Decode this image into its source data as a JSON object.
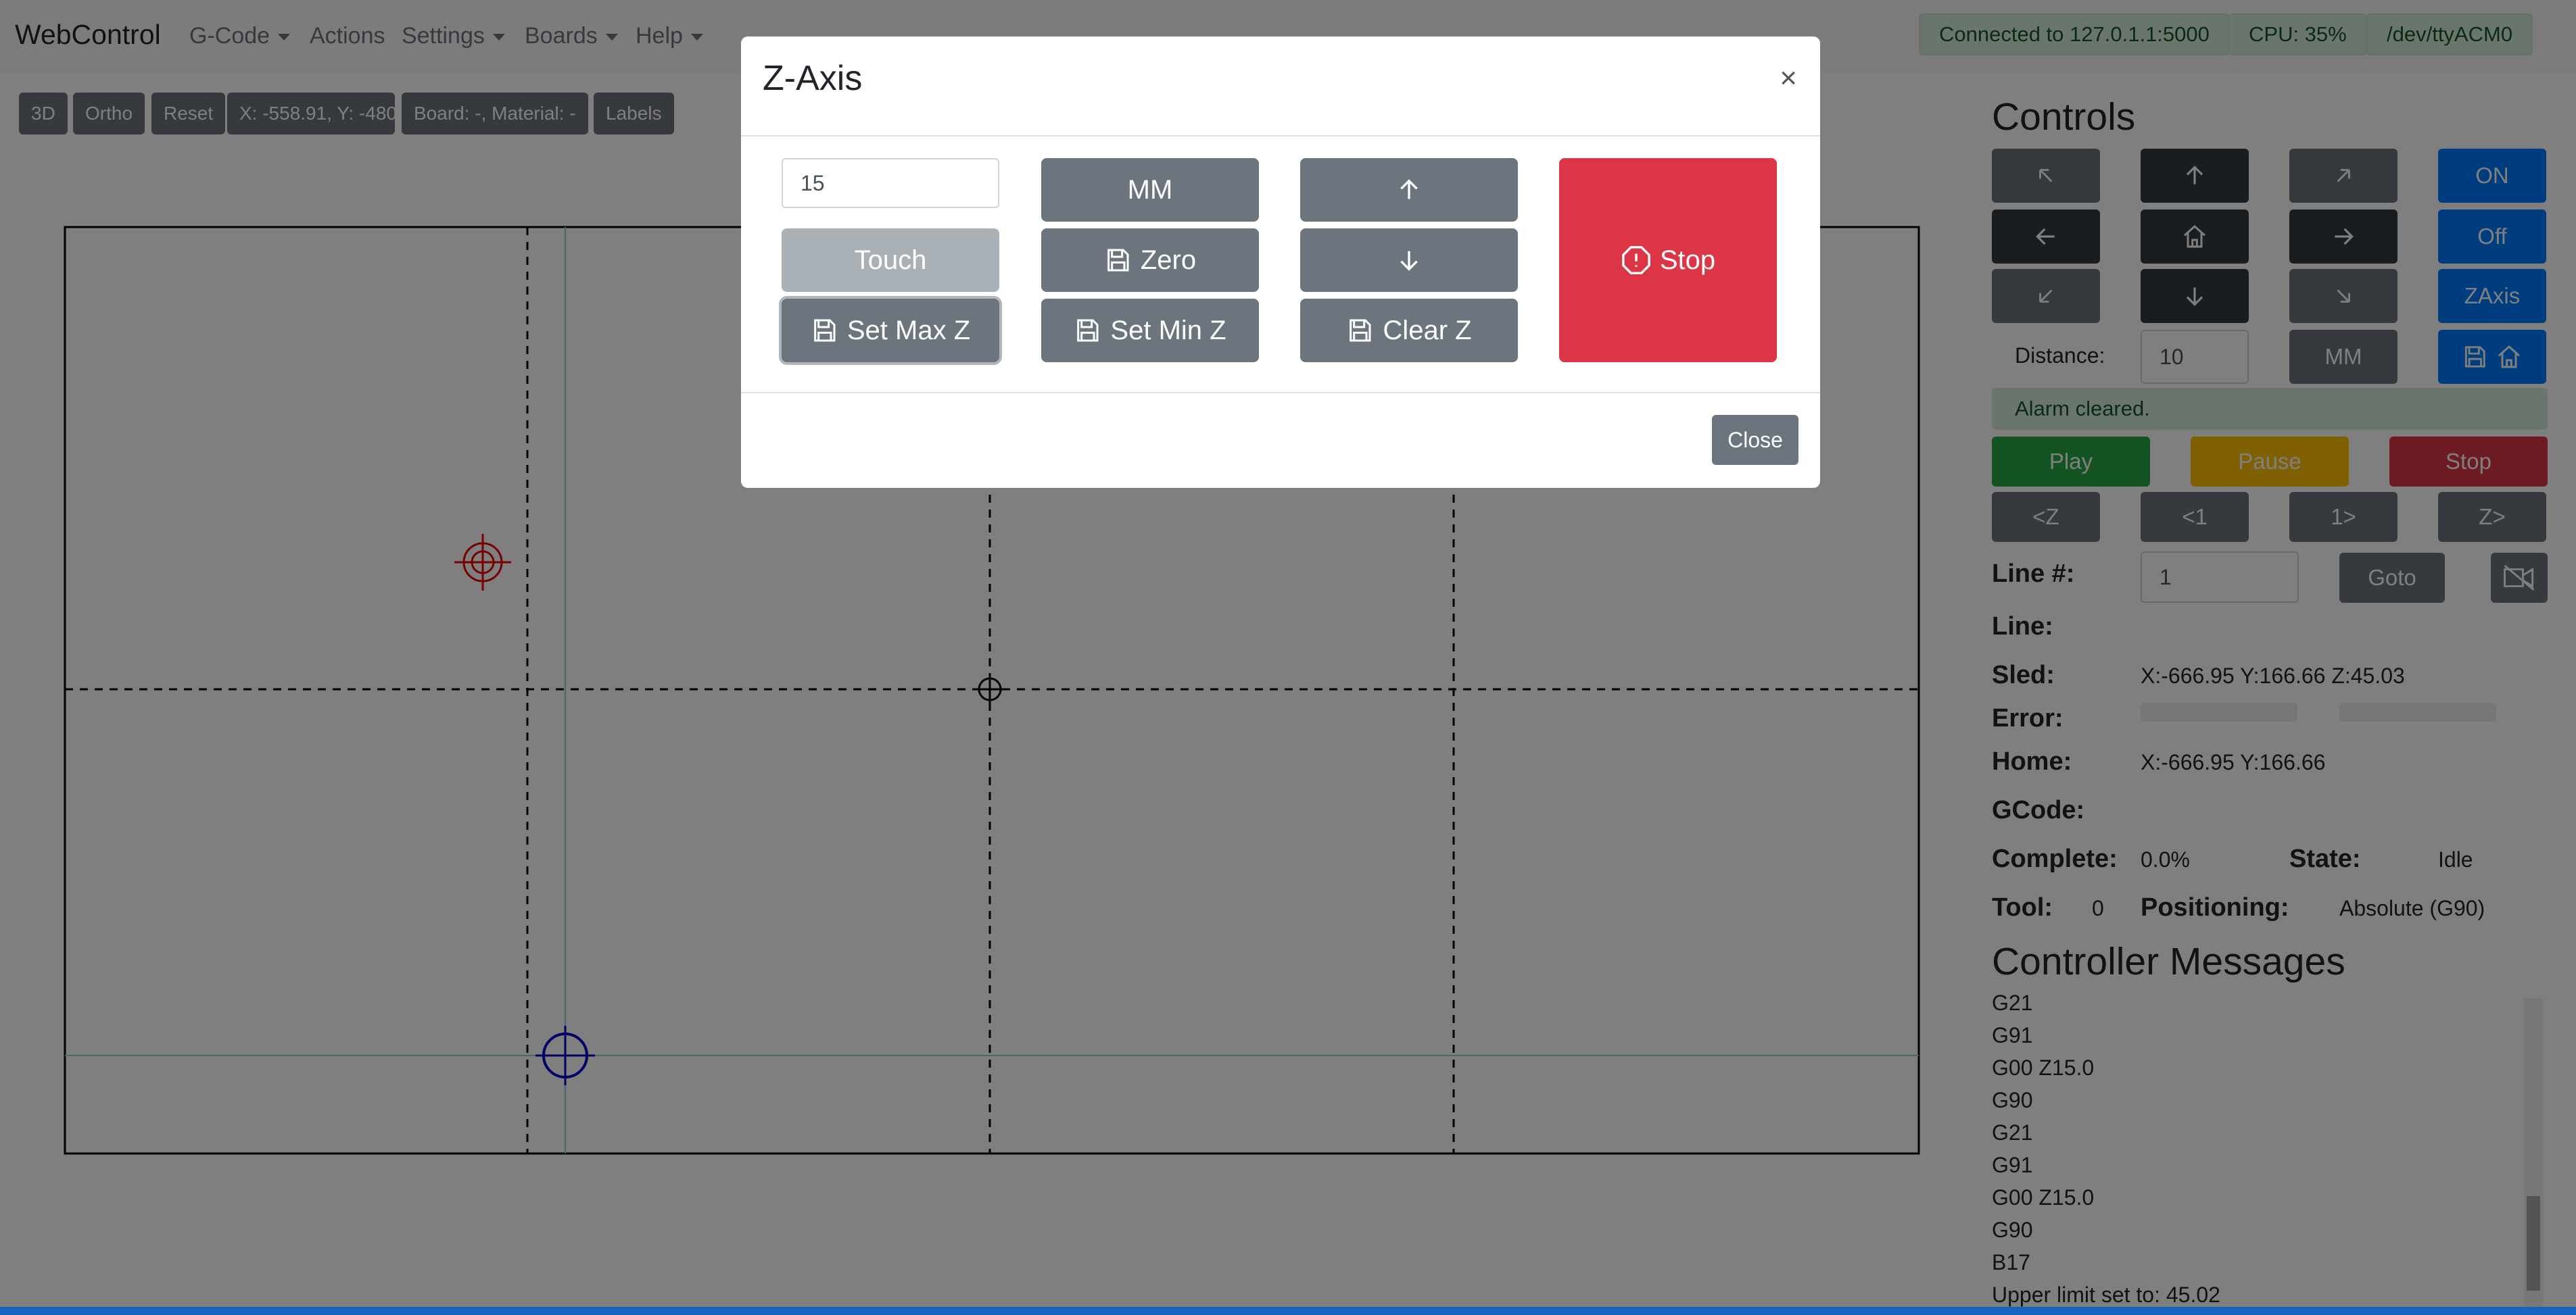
{
  "navbar": {
    "brand": "WebControl",
    "menus": [
      {
        "label": "G-Code",
        "dropdown": true
      },
      {
        "label": "Actions",
        "dropdown": false
      },
      {
        "label": "Settings",
        "dropdown": true
      },
      {
        "label": "Boards",
        "dropdown": true
      },
      {
        "label": "Help",
        "dropdown": true
      }
    ],
    "status": {
      "connection": "Connected to 127.0.1.1:5000",
      "cpu": "CPU: 35%",
      "port": "/dev/ttyACM0"
    }
  },
  "toolbar": {
    "view_3d": "3D",
    "ortho": "Ortho",
    "reset": "Reset",
    "coords": "X: -558.91, Y: -480.",
    "board": "Board: -, Material: -",
    "labels": "Labels"
  },
  "controls": {
    "title": "Controls",
    "on": "ON",
    "off": "Off",
    "zaxis": "ZAxis",
    "distance_label": "Distance:",
    "distance_value": "10",
    "units": "MM",
    "alert": "Alarm cleared.",
    "play": "Play",
    "pause": "Pause",
    "stop": "Stop",
    "prev_z": "<Z",
    "prev_1": "<1",
    "next_1": "1>",
    "next_z": "Z>",
    "line_num_label": "Line #:",
    "line_num_value": "1",
    "goto": "Goto",
    "line_label": "Line:",
    "sled_label": "Sled:",
    "sled_value": "X:-666.95 Y:166.66 Z:45.03",
    "error_label": "Error:",
    "home_label": "Home:",
    "home_value": "X:-666.95 Y:166.66",
    "gcode_label": "GCode:",
    "complete_label": "Complete:",
    "complete_value": "0.0%",
    "state_label": "State:",
    "state_value": "Idle",
    "tool_label": "Tool:",
    "tool_value": "0",
    "positioning_label": "Positioning:",
    "positioning_value": "Absolute (G90)"
  },
  "messages": {
    "title": "Controller Messages",
    "lines": [
      "G21",
      "G91",
      "G00 Z15.0",
      "G90",
      "G21",
      "G91",
      "G00 Z15.0",
      "G90",
      "B17",
      "Upper limit set to: 45.02"
    ]
  },
  "modal": {
    "title": "Z-Axis",
    "close_x": "×",
    "distance_value": "15",
    "units": "MM",
    "touch": "Touch",
    "zero": "Zero",
    "set_max_z": "Set Max Z",
    "set_min_z": "Set Min Z",
    "clear_z": "Clear Z",
    "stop": "Stop",
    "close": "Close"
  },
  "colors": {
    "primary": "#007bff",
    "secondary": "#6c757d",
    "dark": "#343a40",
    "success": "#28a745",
    "warning": "#ffc107",
    "danger": "#dc3545"
  }
}
